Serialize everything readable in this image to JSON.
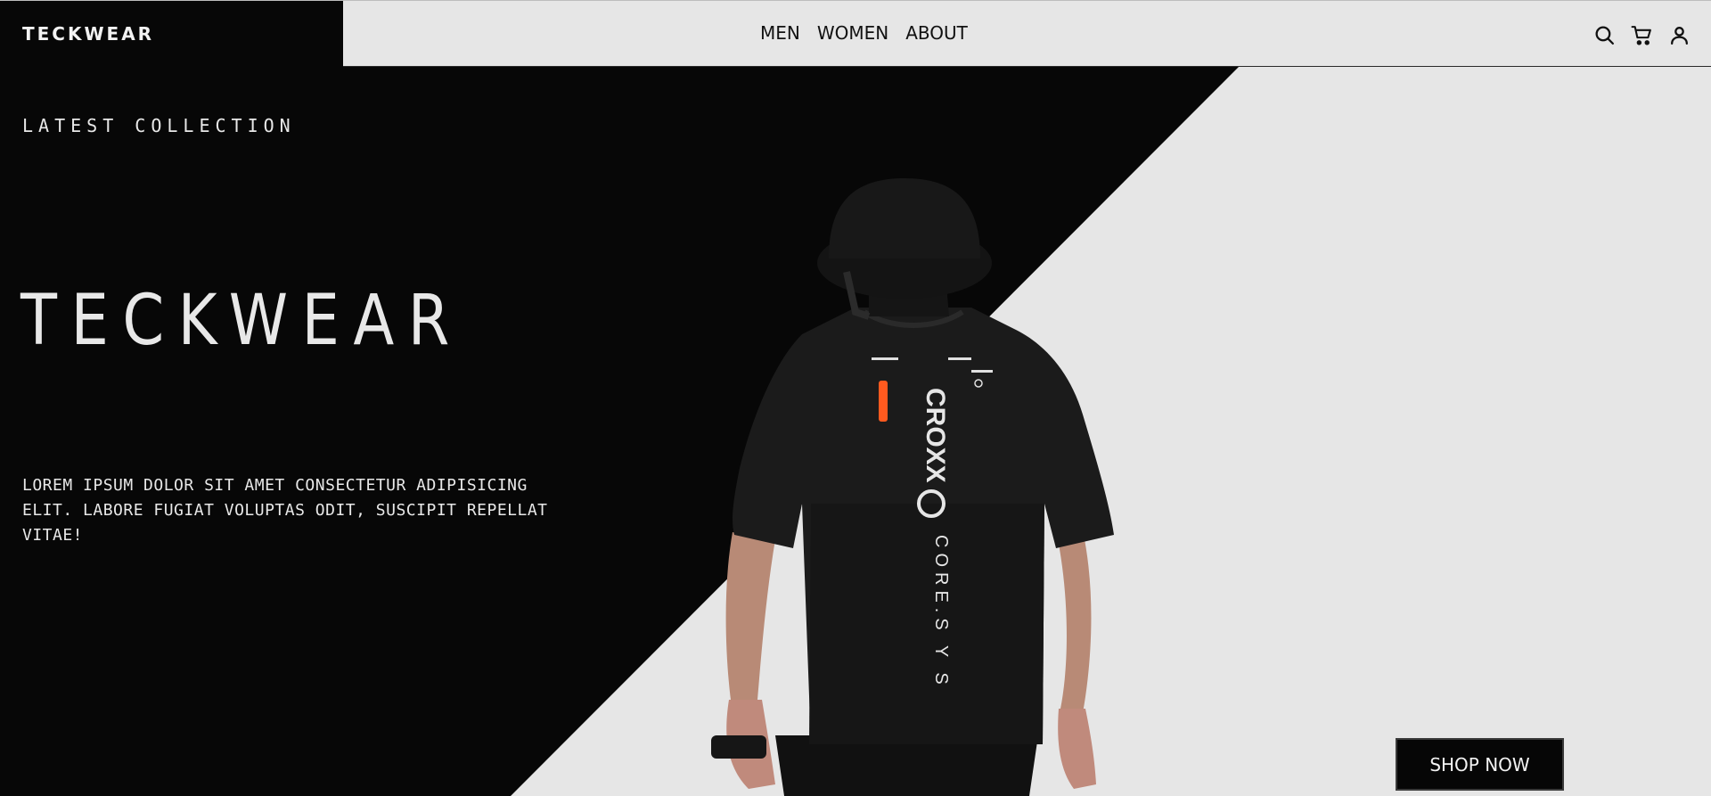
{
  "header": {
    "brand": "TECKWEAR",
    "nav": [
      {
        "label": "MEN"
      },
      {
        "label": "WOMEN"
      },
      {
        "label": "ABOUT"
      }
    ],
    "icons": [
      "search-icon",
      "cart-icon",
      "user-icon"
    ]
  },
  "hero": {
    "eyebrow": "LATEST COLLECTION",
    "title": "TECKWEAR",
    "description": "LOREM IPSUM DOLOR SIT AMET CONSECTETUR ADIPISICING ELIT. LABORE FUGIAT VOLUPTAS ODIT, SUSCIPIT REPELLAT VITAE!",
    "cta_label": "SHOP NOW",
    "shirt_print": {
      "brand_text": "CROXX",
      "sub_text": "CORE.S Y S"
    }
  },
  "colors": {
    "dark": "#070707",
    "light": "#e6e6e6",
    "accent": "#ff5a1f"
  }
}
